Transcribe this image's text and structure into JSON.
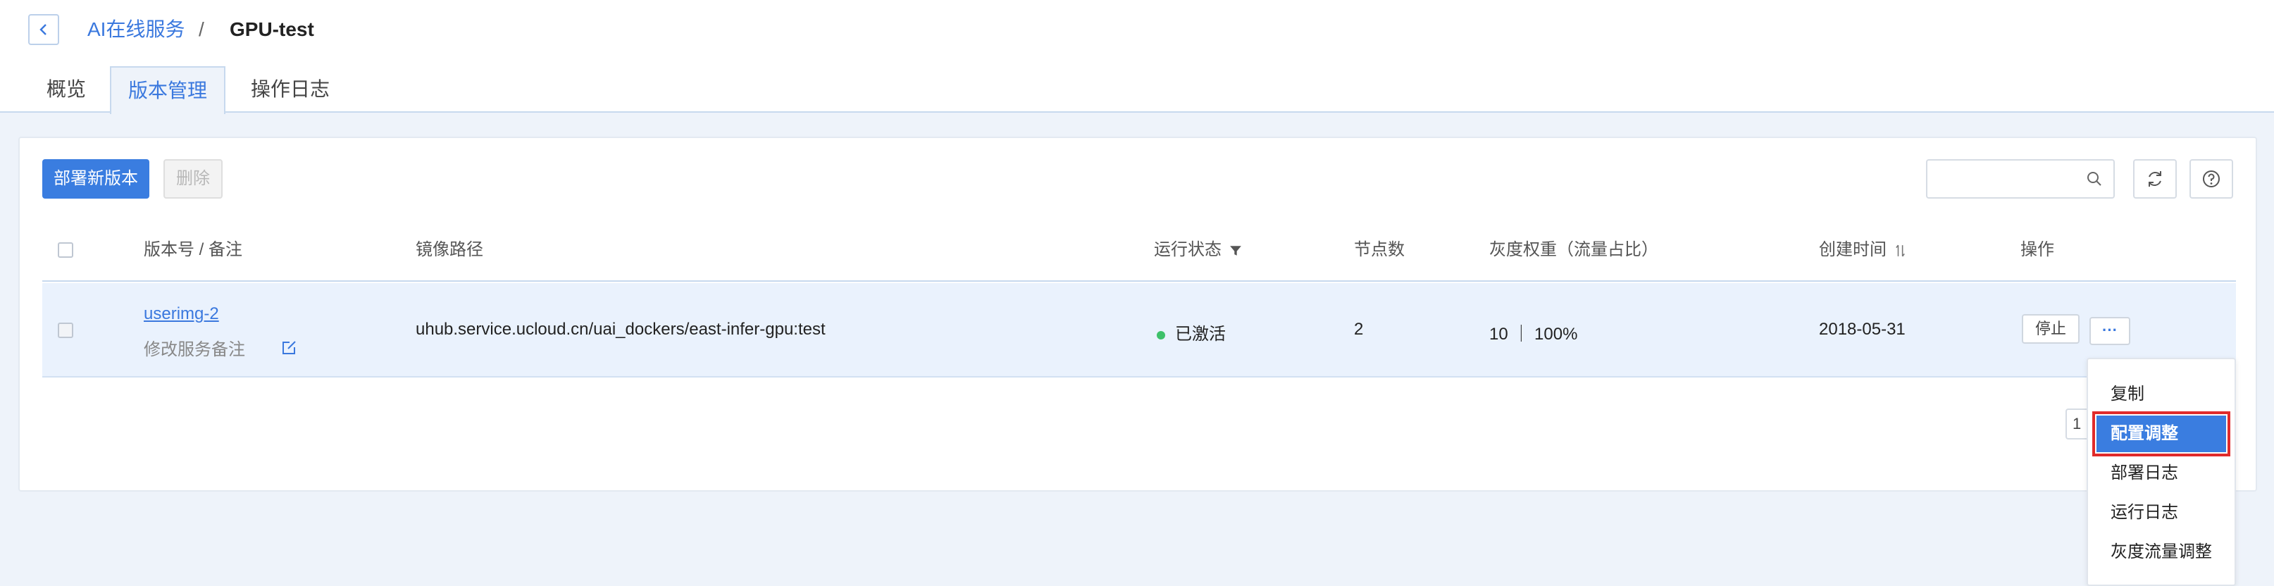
{
  "breadcrumb": {
    "parent": "AI在线服务",
    "separator": "/",
    "current": "GPU-test"
  },
  "tabs": [
    {
      "label": "概览"
    },
    {
      "label": "版本管理"
    },
    {
      "label": "操作日志"
    }
  ],
  "toolbar": {
    "deploy_label": "部署新版本",
    "delete_label": "删除",
    "search_placeholder": ""
  },
  "table": {
    "columns": {
      "version": "版本号 / 备注",
      "image": "镜像路径",
      "status": "运行状态",
      "nodes": "节点数",
      "weight": "灰度权重（流量占比）",
      "created": "创建时间",
      "actions": "操作"
    },
    "rows": [
      {
        "version": "userimg-2",
        "note": "修改服务备注",
        "image": "uhub.service.ucloud.cn/uai_dockers/east-infer-gpu:test",
        "status": "已激活",
        "nodes": "2",
        "weight": "10 ｜ 100%",
        "created": "2018-05-31",
        "stop_label": "停止",
        "more_label": "···"
      }
    ]
  },
  "pager": {
    "page": "1"
  },
  "menu": {
    "items": [
      {
        "label": "复制"
      },
      {
        "label": "配置调整"
      },
      {
        "label": "部署日志"
      },
      {
        "label": "运行日志"
      },
      {
        "label": "灰度流量调整"
      }
    ]
  },
  "colors": {
    "accent": "#3a7de0",
    "status_active": "#3ec16a",
    "highlight_border": "#e02b2b"
  }
}
